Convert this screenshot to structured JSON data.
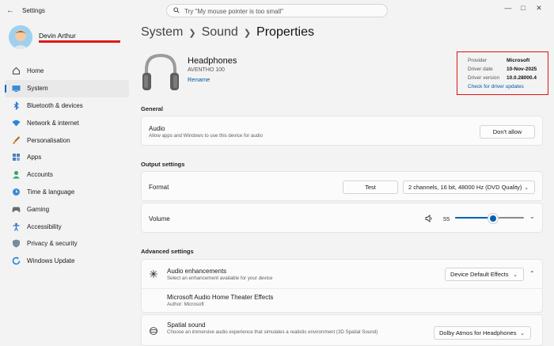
{
  "window": {
    "title": "Settings",
    "search_placeholder": "Try \"My mouse pointer is too small\""
  },
  "user": {
    "name": "Devin Arthur"
  },
  "sidebar": {
    "items": [
      {
        "label": "Home",
        "icon": "home-icon",
        "active": false
      },
      {
        "label": "System",
        "icon": "system-icon",
        "active": true
      },
      {
        "label": "Bluetooth & devices",
        "icon": "bluetooth-icon",
        "active": false
      },
      {
        "label": "Network & internet",
        "icon": "wifi-icon",
        "active": false
      },
      {
        "label": "Personalisation",
        "icon": "brush-icon",
        "active": false
      },
      {
        "label": "Apps",
        "icon": "apps-icon",
        "active": false
      },
      {
        "label": "Accounts",
        "icon": "accounts-icon",
        "active": false
      },
      {
        "label": "Time & language",
        "icon": "globe-clock-icon",
        "active": false
      },
      {
        "label": "Gaming",
        "icon": "gamepad-icon",
        "active": false
      },
      {
        "label": "Accessibility",
        "icon": "accessibility-icon",
        "active": false
      },
      {
        "label": "Privacy & security",
        "icon": "shield-icon",
        "active": false
      },
      {
        "label": "Windows Update",
        "icon": "update-icon",
        "active": false
      }
    ]
  },
  "breadcrumb": [
    "System",
    "Sound",
    "Properties"
  ],
  "device": {
    "name": "Headphones",
    "model": "AVENTHO 100",
    "rename": "Rename",
    "icon": "headphones-icon"
  },
  "driver": {
    "provider_label": "Provider",
    "provider": "Microsoft",
    "date_label": "Driver date",
    "date": "10-Nov-2025",
    "version_label": "Driver version",
    "version": "10.0.28000.4",
    "check_link": "Check for driver updates"
  },
  "general": {
    "title": "General",
    "audio_title": "Audio",
    "audio_sub": "Allow apps and Windows to use this device for audio",
    "dont_allow": "Don't allow"
  },
  "output": {
    "title": "Output settings",
    "format_label": "Format",
    "test_button": "Test",
    "format_value": "2 channels, 16 bit, 48000 Hz (DVD Quality)",
    "volume_label": "Volume",
    "volume_value": "55",
    "volume_level": 0.55
  },
  "advanced": {
    "title": "Advanced settings",
    "enh_title": "Audio enhancements",
    "enh_sub": "Select an enhancement available for your device",
    "enh_value": "Device Default Effects",
    "effects_title": "Microsoft Audio Home Theater Effects",
    "effects_sub": "Author: Microsoft",
    "spatial_title": "Spatial sound",
    "spatial_sub": "Choose an immersive audio experience that simulates a realistic environment (3D Spatial Sound)",
    "spatial_value": "Dolby Atmos for Headphones"
  },
  "colors": {
    "accent": "#0067c0",
    "highlight_box": "#e01010"
  }
}
